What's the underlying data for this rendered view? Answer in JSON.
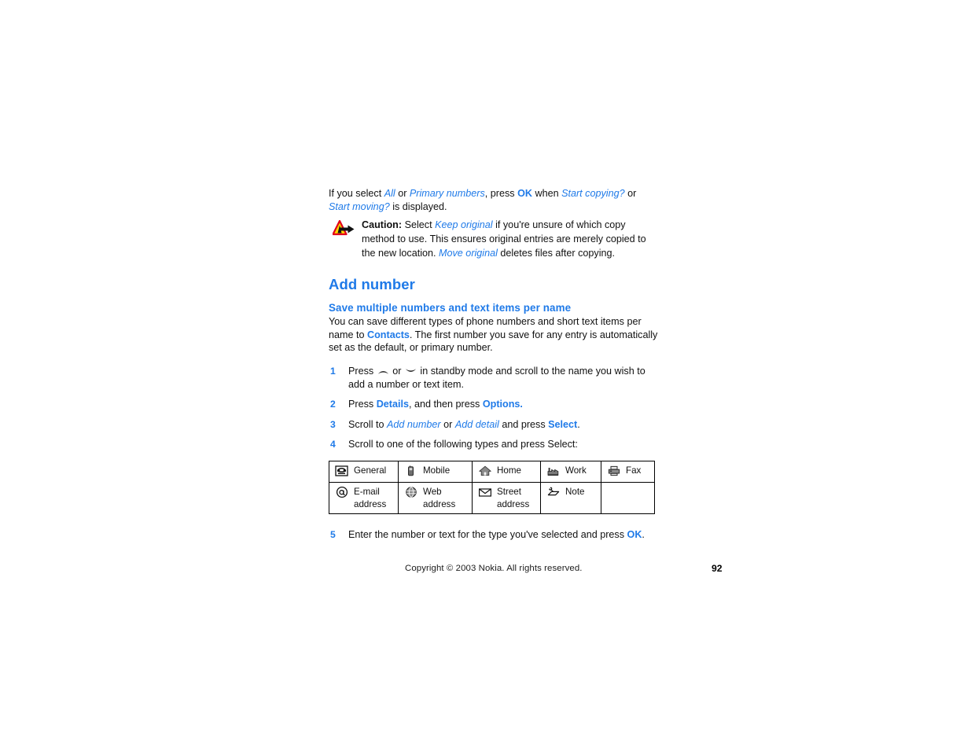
{
  "document": {
    "intro": {
      "line_parts": [
        {
          "text": "If you select ",
          "style": "plain"
        },
        {
          "text": "All",
          "style": "italic-blue"
        },
        {
          "text": " or ",
          "style": "plain"
        },
        {
          "text": "Primary numbers",
          "style": "italic-blue"
        },
        {
          "text": ", press ",
          "style": "plain"
        },
        {
          "text": "OK",
          "style": "bold-blue"
        },
        {
          "text": " when ",
          "style": "plain"
        },
        {
          "text": "Start copying?",
          "style": "italic-blue"
        },
        {
          "text": " or ",
          "style": "plain"
        },
        {
          "text": "Start moving?",
          "style": "italic-blue"
        },
        {
          "text": " is displayed.",
          "style": "plain"
        }
      ],
      "t1": "If you select ",
      "t2": "All",
      "t3": " or ",
      "t4": "Primary numbers",
      "t5": ", press ",
      "t6": "OK",
      "t7": " when ",
      "t8": "Start copying?",
      "t9": " or ",
      "t10": "Start moving?",
      "t11": " is displayed."
    },
    "caution": {
      "icon": "warning-triangle-arrow-icon",
      "label": "Caution:",
      "t1": " Select ",
      "t2": "Keep original",
      "t3": " if you're unsure of which copy method to use. This ensures original entries are merely copied to the new location. ",
      "t4": "Move original",
      "t5": " deletes files after copying."
    },
    "heading_main": "Add number",
    "heading_sub": "Save multiple numbers and text items per name",
    "body": {
      "t1": "You can save different types of phone numbers and short text items per name to ",
      "t2": "Contacts",
      "t3": ". The first number you save for any entry is automatically set as the default, or primary number."
    },
    "steps": [
      {
        "number": "1",
        "t1": "Press ",
        "icon_up": "scroll-up-arrow-icon",
        "t2": " or ",
        "icon_down": "scroll-down-arrow-icon",
        "t3": " in standby mode and scroll to the name you wish to add a number or text item."
      },
      {
        "number": "2",
        "t1": "Press ",
        "t2": "Details",
        "t3": ", and then press ",
        "t4": "Options."
      },
      {
        "number": "3",
        "t1": "Scroll to ",
        "t2": "Add number",
        "t3": " or ",
        "t4": "Add detail",
        "t5": " and press ",
        "t6": "Select",
        "t7": "."
      },
      {
        "number": "4",
        "t1": "Scroll to one of the following types and press Select:"
      },
      {
        "number": "5",
        "t1": "Enter the number or text for the type you've selected and press ",
        "t2": "OK",
        "t3": "."
      }
    ],
    "types_table": {
      "rows": [
        [
          {
            "icon": "boxed-telephone-icon",
            "label": "General"
          },
          {
            "icon": "mobile-phone-icon",
            "label": "Mobile"
          },
          {
            "icon": "house-icon",
            "label": "Home"
          },
          {
            "icon": "factory-icon",
            "label": "Work"
          },
          {
            "icon": "fax-machine-icon",
            "label": "Fax"
          }
        ],
        [
          {
            "icon": "at-sign-icon",
            "label": "E-mail address"
          },
          {
            "icon": "globe-icon",
            "label": "Web address"
          },
          {
            "icon": "envelope-icon",
            "label": "Street address"
          },
          {
            "icon": "note-pencil-icon",
            "label": "Note"
          },
          {
            "icon": "",
            "label": ""
          }
        ]
      ]
    },
    "footer": {
      "copyright": "Copyright © 2003 Nokia. All rights reserved.",
      "page_number": "92"
    },
    "colors": {
      "accent_blue": "#1f7ae8",
      "text_black": "#111111",
      "warning_yellow": "#ffd400",
      "warning_red": "#e2001a",
      "icon_gray": "#7a7a7a"
    }
  }
}
